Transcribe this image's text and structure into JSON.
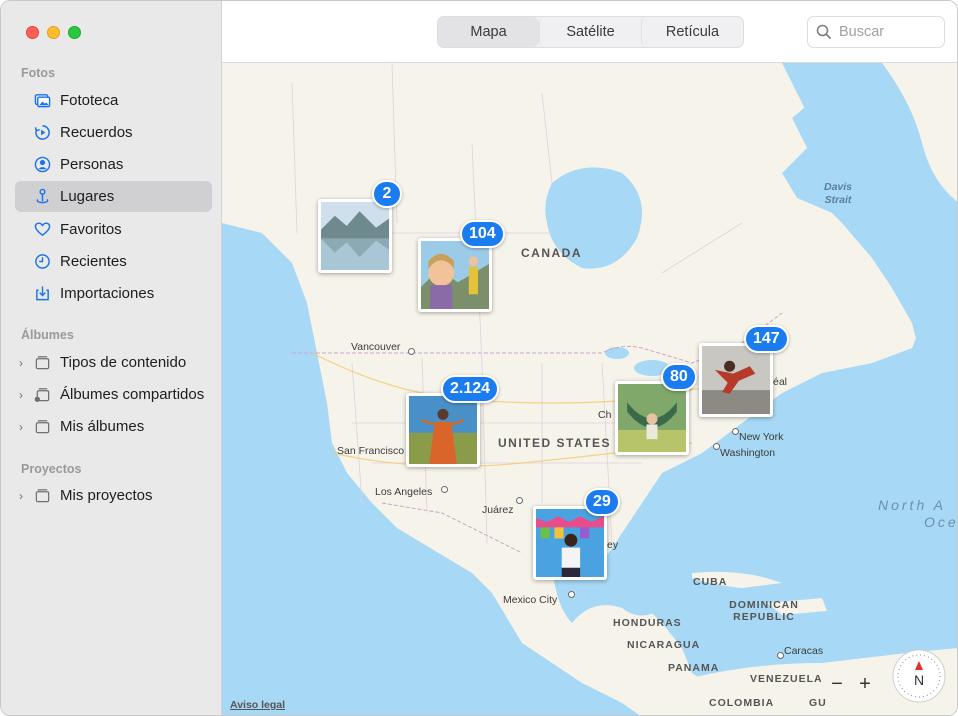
{
  "sidebar": {
    "section_photos": "Fotos",
    "items": [
      {
        "label": "Fototeca",
        "icon": "photo-library-icon"
      },
      {
        "label": "Recuerdos",
        "icon": "memories-icon"
      },
      {
        "label": "Personas",
        "icon": "people-icon"
      },
      {
        "label": "Lugares",
        "icon": "places-pin-icon",
        "selected": true
      },
      {
        "label": "Favoritos",
        "icon": "heart-icon"
      },
      {
        "label": "Recientes",
        "icon": "clock-icon"
      },
      {
        "label": "Importaciones",
        "icon": "import-icon"
      }
    ],
    "section_albums": "Álbumes",
    "albums": [
      {
        "label": "Tipos de contenido",
        "icon": "folder-stack-icon"
      },
      {
        "label": "Álbumes compartidos",
        "icon": "shared-albums-icon"
      },
      {
        "label": "Mis álbumes",
        "icon": "folder-stack-icon"
      }
    ],
    "section_projects": "Proyectos",
    "projects": [
      {
        "label": "Mis proyectos",
        "icon": "folder-stack-icon"
      }
    ]
  },
  "toolbar": {
    "tabs": [
      "Mapa",
      "Satélite",
      "Retícula"
    ],
    "active_tab": "Mapa",
    "search_placeholder": "Buscar"
  },
  "map": {
    "countries": [
      "CANADA",
      "UNITED STATES",
      "CUBA",
      "DOMINICAN REPUBLIC",
      "HONDURAS",
      "NICARAGUA",
      "PANAMA",
      "VENEZUELA",
      "COLOMBIA"
    ],
    "cities": [
      "Vancouver",
      "San Francisco",
      "Los Angeles",
      "Juárez",
      "Mexico City",
      "New York",
      "Washington",
      "Caracas",
      "Ch",
      "éal",
      "ey",
      "GU"
    ],
    "water": [
      "Davis",
      "Strait",
      "North A",
      "Oce"
    ],
    "clusters": [
      {
        "count": "2"
      },
      {
        "count": "104"
      },
      {
        "count": "2.124"
      },
      {
        "count": "80"
      },
      {
        "count": "147"
      },
      {
        "count": "29"
      }
    ],
    "legal_link": "Aviso legal",
    "zoom_out": "−",
    "zoom_in": "+",
    "compass_letter": "N"
  },
  "colors": {
    "water": "#a7d8f5",
    "land": "#f6f3ea",
    "badge": "#1b7cf0",
    "sidebar_bg": "#e9e9ea",
    "accent_icon": "#1a73e8"
  }
}
